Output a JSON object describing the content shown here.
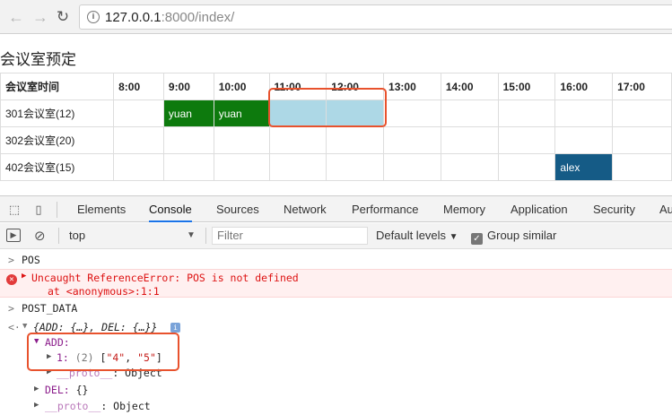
{
  "browser": {
    "url_host": "127.0.0.1",
    "url_rest": ":8000/index/"
  },
  "page": {
    "title": "会议室预定",
    "table": {
      "header": [
        "会议室时间",
        "8:00",
        "9:00",
        "10:00",
        "11:00",
        "12:00",
        "13:00",
        "14:00",
        "15:00",
        "16:00",
        "17:00"
      ],
      "rows": [
        {
          "room": "301会议室(12)",
          "cells": [
            "",
            "yuan",
            "yuan",
            "",
            "",
            "",
            "",
            "",
            "",
            ""
          ]
        },
        {
          "room": "302会议室(20)",
          "cells": [
            "",
            "",
            "",
            "",
            "",
            "",
            "",
            "",
            "",
            ""
          ]
        },
        {
          "room": "402会议室(15)",
          "cells": [
            "",
            "",
            "",
            "",
            "",
            "",
            "",
            "",
            "alex",
            ""
          ]
        }
      ]
    },
    "colors": {
      "booked_green": "#0d7a0d",
      "booked_blue": "#155b86",
      "selected": "#add8e6",
      "highlight": "#e8522d"
    }
  },
  "devtools": {
    "tabs": [
      "Elements",
      "Console",
      "Sources",
      "Network",
      "Performance",
      "Memory",
      "Application",
      "Security",
      "Au"
    ],
    "active_tab": "Console",
    "context": "top",
    "filter_placeholder": "Filter",
    "levels": "Default levels",
    "group_similar": "Group similar",
    "console_lines": {
      "cmd1": "POS",
      "error_main": "Uncaught ReferenceError: POS is not defined",
      "error_at": "at <anonymous>:1:1",
      "cmd2": "POST_DATA",
      "obj_summary": "{ADD: {…}, DEL: {…}}",
      "add_key": "ADD:",
      "add_item_index": "1:",
      "add_item_len": "(2)",
      "add_item_open": "[",
      "add_item_v1": "\"4\"",
      "add_item_sep": ", ",
      "add_item_v2": "\"5\"",
      "add_item_close": "]",
      "proto_key": "__proto__",
      "proto_val": ": Object",
      "del_key": "DEL:",
      "del_val": " {}",
      "proto2_key": "__proto__",
      "proto2_val": ": Object"
    }
  }
}
